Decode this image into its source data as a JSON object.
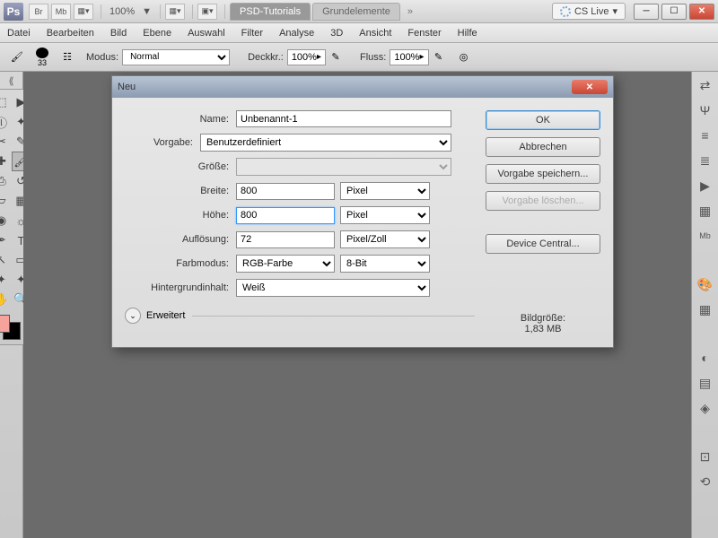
{
  "titlebar": {
    "logo": "Ps",
    "small1": "Br",
    "small2": "Mb",
    "zoom": "100%",
    "arrow": "▼",
    "tab_active": "PSD-Tutorials",
    "tab_inactive": "Grundelemente",
    "cslive": "CS Live",
    "more": "»"
  },
  "menu": [
    "Datei",
    "Bearbeiten",
    "Bild",
    "Ebene",
    "Auswahl",
    "Filter",
    "Analyse",
    "3D",
    "Ansicht",
    "Fenster",
    "Hilfe"
  ],
  "optbar": {
    "brush_size": "33",
    "modus_label": "Modus:",
    "modus_value": "Normal",
    "deckkr_label": "Deckkr.:",
    "deckkr_value": "100%",
    "fluss_label": "Fluss:",
    "fluss_value": "100%"
  },
  "dialog": {
    "title": "Neu",
    "name_label": "Name:",
    "name_value": "Unbenannt-1",
    "vorgabe_label": "Vorgabe:",
    "vorgabe_value": "Benutzerdefiniert",
    "groesse_label": "Größe:",
    "breite_label": "Breite:",
    "breite_value": "800",
    "breite_unit": "Pixel",
    "hoehe_label": "Höhe:",
    "hoehe_value": "800",
    "hoehe_unit": "Pixel",
    "aufl_label": "Auflösung:",
    "aufl_value": "72",
    "aufl_unit": "Pixel/Zoll",
    "farb_label": "Farbmodus:",
    "farb_value": "RGB-Farbe",
    "farb_bits": "8-Bit",
    "hg_label": "Hintergrundinhalt:",
    "hg_value": "Weiß",
    "erweitert": "Erweitert",
    "ok": "OK",
    "abbrechen": "Abbrechen",
    "vorgabe_speichern": "Vorgabe speichern...",
    "vorgabe_loeschen": "Vorgabe löschen...",
    "device_central": "Device Central...",
    "bildgroesse_label": "Bildgröße:",
    "bildgroesse_value": "1,83 MB"
  }
}
